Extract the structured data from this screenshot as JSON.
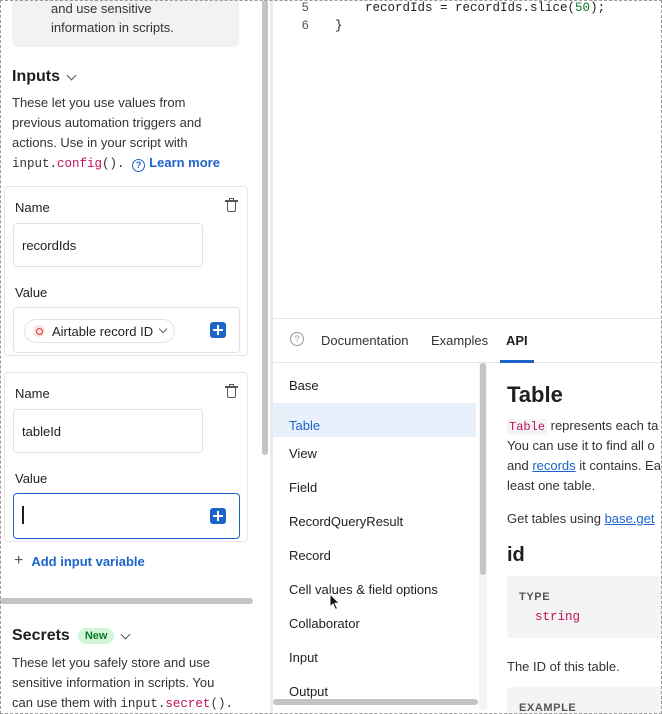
{
  "left_panel": {
    "top_note": {
      "line1": "and use sensitive",
      "line2": "information in scripts."
    },
    "inputs": {
      "title": "Inputs",
      "desc_line1": "These let you use values from",
      "desc_line2": "previous automation triggers and",
      "desc_line3": "actions. Use in your script with",
      "code_obj": "input.",
      "code_fn": "config",
      "code_tail": "().",
      "learn_more": "Learn more"
    },
    "variables": [
      {
        "name_label": "Name",
        "name_value": "recordIds",
        "value_label": "Value",
        "value_pill": "Airtable record ID"
      },
      {
        "name_label": "Name",
        "name_value": "tableId",
        "value_label": "Value",
        "value_text": ""
      }
    ],
    "add_variable": "Add input variable",
    "secrets": {
      "title": "Secrets",
      "badge": "New",
      "desc_line1": "These let you safely store and use",
      "desc_line2": "sensitive information in scripts. You",
      "desc_line3_pre": "can use them with",
      "code_obj": "input.",
      "code_fn": "secret",
      "code_tail": "()."
    }
  },
  "editor": {
    "lines": [
      {
        "number": "5",
        "pre": "    recordIds = recordIds.slice(",
        "num": "50",
        "post": ");"
      },
      {
        "number": "6",
        "pre": "}",
        "num": "",
        "post": ""
      }
    ]
  },
  "docs": {
    "tabs": [
      "Documentation",
      "Examples",
      "API"
    ],
    "active_tab": "API",
    "list_items": [
      "Base",
      "Table",
      "View",
      "Field",
      "RecordQueryResult",
      "Record",
      "Cell values & field options",
      "Collaborator",
      "Input",
      "Output"
    ],
    "selected_item": "Table",
    "content": {
      "heading": "Table",
      "p1_code": "Table",
      "p1_rest": " represents each ta",
      "p2": "You can use it to find all o",
      "p3_pre": "and ",
      "p3_link": "records",
      "p3_post": " it contains. Ea",
      "p4": "least one table.",
      "p5_pre": "Get tables using ",
      "p5_link": "base.get",
      "id_heading": "id",
      "type_label": "TYPE",
      "type_value": "string",
      "id_desc": "The ID of this table.",
      "example_label": "EXAMPLE"
    }
  },
  "colors": {
    "accent": "#1d64c8",
    "code_keyword": "#c0125d",
    "code_number": "#0b7a2a",
    "badge_bg": "#d3f5d8"
  }
}
